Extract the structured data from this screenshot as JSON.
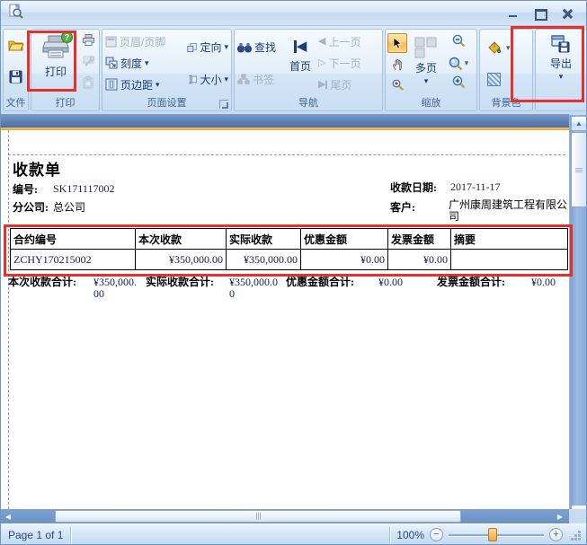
{
  "icons": {
    "dropdown_arrow": "▾",
    "up_arrow": "▲",
    "down_arrow": "▼",
    "left_arrow": "◀",
    "right_arrow": "▶",
    "left_arrow_hollow": "◁",
    "right_arrow_hollow": "▷",
    "minus": "−",
    "plus": "+"
  },
  "ribbon": {
    "groups": {
      "file": {
        "label": "文件"
      },
      "print": {
        "label": "打印",
        "big_button": "打印"
      },
      "page_setup": {
        "label": "页面设置",
        "header_footer": "页眉/页脚",
        "scale": "刻度",
        "margins": "页边距",
        "orientation": "定向",
        "size": "大小"
      },
      "navigation": {
        "label": "导航",
        "find": "查找",
        "bookmark": "书签",
        "first_page": "首页",
        "prev_page": "上一页",
        "next_page": "下一页",
        "last_page": "尾页"
      },
      "zoom": {
        "label": "缩放",
        "multi_page": "多页"
      },
      "background": {
        "label": "背景色"
      },
      "export": {
        "big_button": "导出"
      }
    }
  },
  "document": {
    "title": "收款单",
    "fields": {
      "number": {
        "label": "编号:",
        "value": "SK171117002"
      },
      "branch": {
        "label": "分公司:",
        "value": "总公司"
      },
      "date": {
        "label": "收款日期:",
        "value": "2017-11-17"
      },
      "customer": {
        "label": "客户:",
        "value": "广州康周建筑工程有限公司"
      }
    },
    "table": {
      "headers": [
        "合约编号",
        "本次收款",
        "实际收款",
        "优惠金额",
        "发票金额",
        "摘要"
      ],
      "rows": [
        [
          "ZCHY170215002",
          "¥350,000.00",
          "¥350,000.00",
          "¥0.00",
          "¥0.00",
          ""
        ]
      ]
    },
    "totals": [
      {
        "label": "本次收款合计:",
        "lines": [
          "¥350,000.",
          "00"
        ]
      },
      {
        "label": "实际收款合计:",
        "lines": [
          "¥350,000.0",
          "0"
        ]
      },
      {
        "label": "优惠金额合计:",
        "lines": [
          "¥0.00"
        ]
      },
      {
        "label": "发票金额合计:",
        "lines": [
          "¥0.00"
        ]
      }
    ]
  },
  "status_bar": {
    "page_info": "Page 1 of 1",
    "zoom_level": "100%"
  },
  "colors": {
    "annotation_red": "#e5302c",
    "strip_blue": "#5d81b5",
    "strip_orange": "#f0a63c",
    "selected_tool_orange": "#fcb64b"
  }
}
